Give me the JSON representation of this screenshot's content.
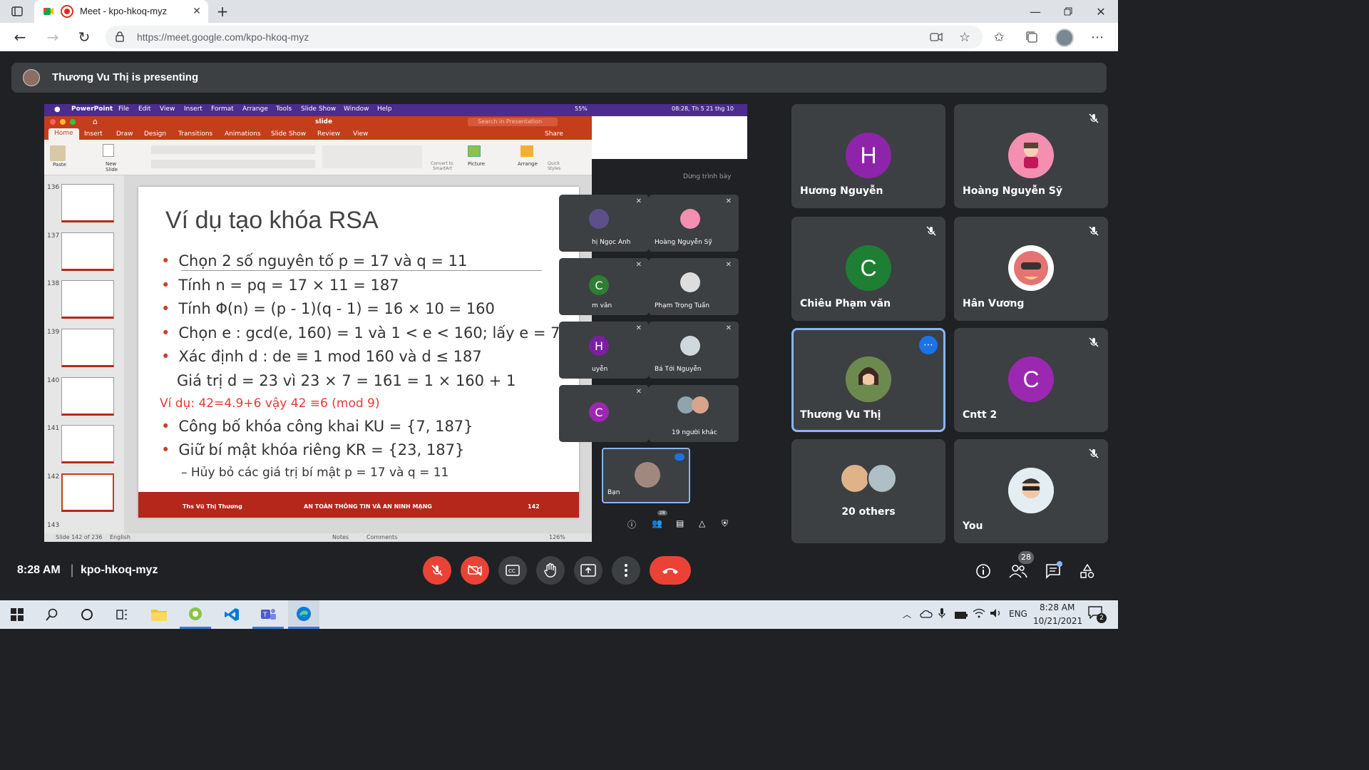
{
  "browser": {
    "tab_title": "Meet - kpo-hkoq-myz",
    "url": "https://meet.google.com/kpo-hkoq-myz"
  },
  "meet": {
    "presenting_text": "Thương Vu Thị is presenting",
    "time": "8:28 AM",
    "meeting_code": "kpo-hkoq-myz",
    "people_count": "28"
  },
  "mac_menu": {
    "app": "PowerPoint",
    "items": [
      "File",
      "Edit",
      "View",
      "Insert",
      "Format",
      "Arrange",
      "Tools",
      "Slide Show",
      "Window",
      "Help"
    ],
    "battery": "55%",
    "clock": "08:28, Th 5 21 thg 10"
  },
  "ppt": {
    "doc_title": "slide",
    "search_placeholder": "Search in Presentation",
    "share": "Share",
    "tabs": [
      "Home",
      "Insert",
      "Draw",
      "Design",
      "Transitions",
      "Animations",
      "Slide Show",
      "Review",
      "View"
    ],
    "ribbon": {
      "paste": "Paste",
      "new_slide_1": "New",
      "new_slide_2": "Slide",
      "convert_1": "Convert to",
      "convert_2": "SmartArt",
      "picture": "Picture",
      "arrange": "Arrange",
      "quick_1": "Quick",
      "quick_2": "Styles"
    },
    "thumb_numbers": [
      "136",
      "137",
      "138",
      "139",
      "140",
      "141",
      "142",
      "143"
    ],
    "status": {
      "slide_of": "Slide 142 of 236",
      "language": "English",
      "notes": "Notes",
      "comments": "Comments",
      "zoom": "126%"
    }
  },
  "slide": {
    "title": "Ví dụ tạo khóa RSA",
    "lines": [
      "Chọn 2 số nguyên tố p = 17 và q = 11",
      "Tính n = pq = 17 × 11 = 187",
      "Tính Φ(n) = (p - 1)(q - 1) = 16 × 10 = 160",
      "Chọn e : gcd(e, 160) = 1 và 1 < e < 160; lấy e = 7",
      "Xác định d : de ≡ 1 mod 160 và d ≤ 187"
    ],
    "d_value": "Giá trị d = 23 vì 23 × 7 = 161 = 1 × 160 + 1",
    "example_red": "Ví dụ: 42=4.9+6 vậy 42 ≡6 (mod 9)",
    "lines2": [
      "Công bố khóa công khai KU = {7, 187}",
      "Giữ bí mật khóa riêng KR = {23, 187}"
    ],
    "sub_line": "– Hủy bỏ các giá trị bí mật p = 17 và q = 11",
    "footer_author": "Ths Vũ Thị Thương",
    "footer_course": "AN TOÀN THÔNG TIN VÀ AN NINH MẠNG",
    "footer_page": "142"
  },
  "inner_meet": {
    "stop_presenting": "Dừng trình bày",
    "tiles": [
      "hị Ngọc Anh",
      "Hoàng Nguyễn Sỹ",
      "m văn",
      "Phạm Trọng Tuấn",
      "uyễn",
      "Bá Tới Nguyễn",
      "19 người khác"
    ],
    "self_label": "Bạn",
    "people_badge": "28",
    "letter_c": "C",
    "letter_h": "H"
  },
  "participants": [
    {
      "name": "Hương Nguyễn",
      "letter": "H",
      "color": "#8e24aa"
    },
    {
      "name": "Hoàng Nguyễn Sỹ"
    },
    {
      "name": "Chiêu Phạm văn",
      "letter": "C",
      "color": "#1e7e34"
    },
    {
      "name": "Hân Vương"
    },
    {
      "name": "Thương Vu Thị"
    },
    {
      "name": "Cntt 2",
      "letter": "C",
      "color": "#9c27b0"
    },
    {
      "name": "20 others"
    },
    {
      "name": "You"
    }
  ],
  "taskbar": {
    "lang": "ENG",
    "time": "8:28 AM",
    "date": "10/21/2021"
  }
}
